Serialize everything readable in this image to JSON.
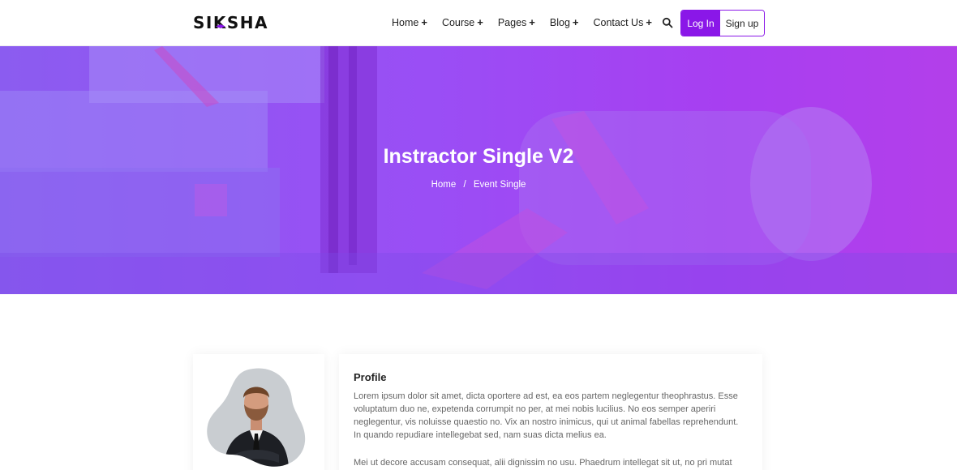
{
  "header": {
    "logo_text": "SIKSHA",
    "nav": [
      {
        "label": "Home"
      },
      {
        "label": "Course"
      },
      {
        "label": "Pages"
      },
      {
        "label": "Blog"
      },
      {
        "label": "Contact Us"
      }
    ],
    "nav_expand_symbol": "+",
    "search_icon": "search-icon",
    "login_label": "Log In",
    "signup_label": "Sign up"
  },
  "hero": {
    "title": "Instractor Single V2",
    "breadcrumb": {
      "home": "Home",
      "separator": "/",
      "current": "Event Single"
    }
  },
  "profile": {
    "title": "Profile",
    "paragraph_1": "Lorem ipsum dolor sit amet, dicta oportere ad est, ea eos partem neglegentur theophrastus. Esse voluptatum duo ne, expetenda corrumpit no per, at mei nobis lucilius. No eos semper aperiri neglegentur, vis noluisse quaestio no. Vix an nostro inimicus, qui ut animal fabellas reprehendunt. In quando repudiare intellegebat sed, nam suas dicta melius ea.",
    "paragraph_2": "Mei ut decore accusam consequat, alii dignissim no usu. Phaedrum intellegat sit ut, no pri mutat"
  },
  "colors": {
    "accent": "#8a17e8",
    "hero_start": "#8b5cf0",
    "hero_end": "#b33fea"
  }
}
